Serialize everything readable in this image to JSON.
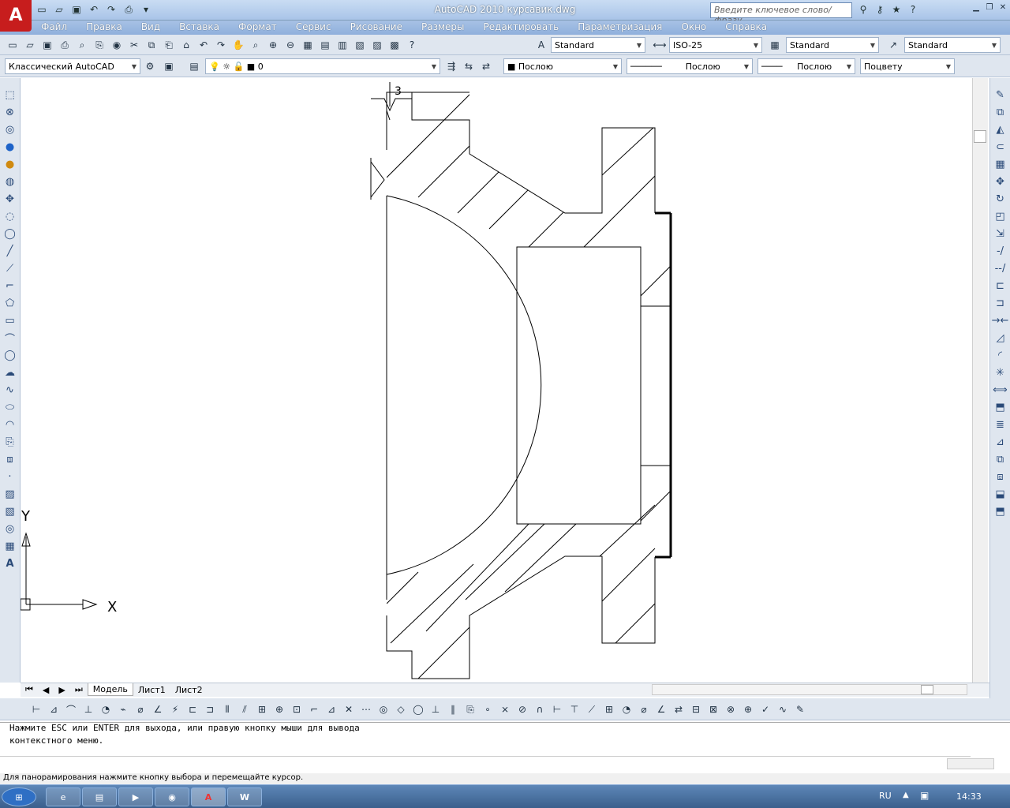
{
  "window": {
    "title": "AutoCAD 2010    курсавик.dwg",
    "app_logo": "A",
    "search_placeholder": "Введите ключевое слово/фразу"
  },
  "menu": [
    "Файл",
    "Правка",
    "Вид",
    "Вставка",
    "Формат",
    "Сервис",
    "Рисование",
    "Размеры",
    "Редактировать",
    "Параметризация",
    "Окно",
    "Справка"
  ],
  "toolbar": {
    "text_style": "Standard",
    "dim_style": "ISO-25",
    "table_style": "Standard",
    "mleader_style": "Standard",
    "workspace": "Классический AutoCAD",
    "layer": "0",
    "color": "Послою",
    "linetype": "Послою",
    "lineweight": "Послою",
    "plotstyle": "Поцвету"
  },
  "drawing": {
    "annotation": "3",
    "ucs_x": "X",
    "ucs_y": "Y"
  },
  "tabs": [
    "Модель",
    "Лист1",
    "Лист2"
  ],
  "command": {
    "line1": "Нажмите ESC или ENTER для выхода, или правую кнопку мыши для вывода",
    "line2": "контекстного меню."
  },
  "status": "Для панорамирования нажмите кнопку выбора и перемещайте курсор.",
  "taskbar": {
    "lang": "RU",
    "time": "14:33"
  },
  "icons": [
    "save-icon",
    "open-icon",
    "undo-icon",
    "redo-icon",
    "print-icon",
    "zoom-icon",
    "line-icon",
    "circle-icon",
    "layer-icon"
  ]
}
